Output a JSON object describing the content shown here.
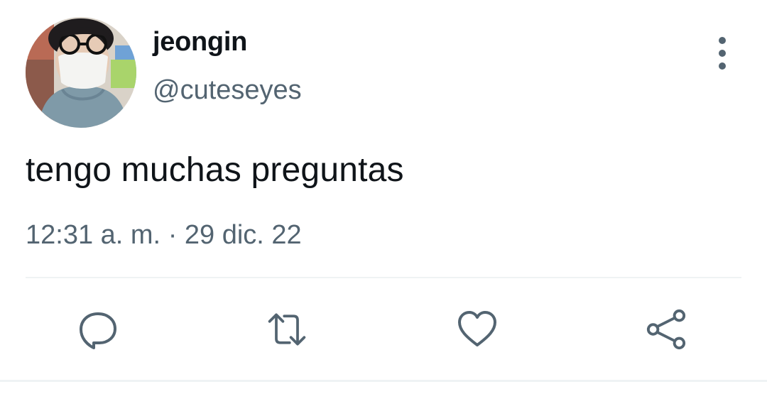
{
  "user": {
    "display_name": "jeongin",
    "handle": "@cuteseyes"
  },
  "tweet": {
    "text": "tengo muchas preguntas",
    "time": "12:31 a. m.",
    "separator": "·",
    "date": "29 dic. 22"
  },
  "actions": [
    {
      "name": "reply",
      "icon": "reply-icon"
    },
    {
      "name": "retweet",
      "icon": "retweet-icon"
    },
    {
      "name": "like",
      "icon": "heart-icon"
    },
    {
      "name": "share",
      "icon": "share-icon"
    }
  ],
  "colors": {
    "text_primary": "#0f1419",
    "text_secondary": "#536471",
    "divider": "#eff3f4"
  }
}
